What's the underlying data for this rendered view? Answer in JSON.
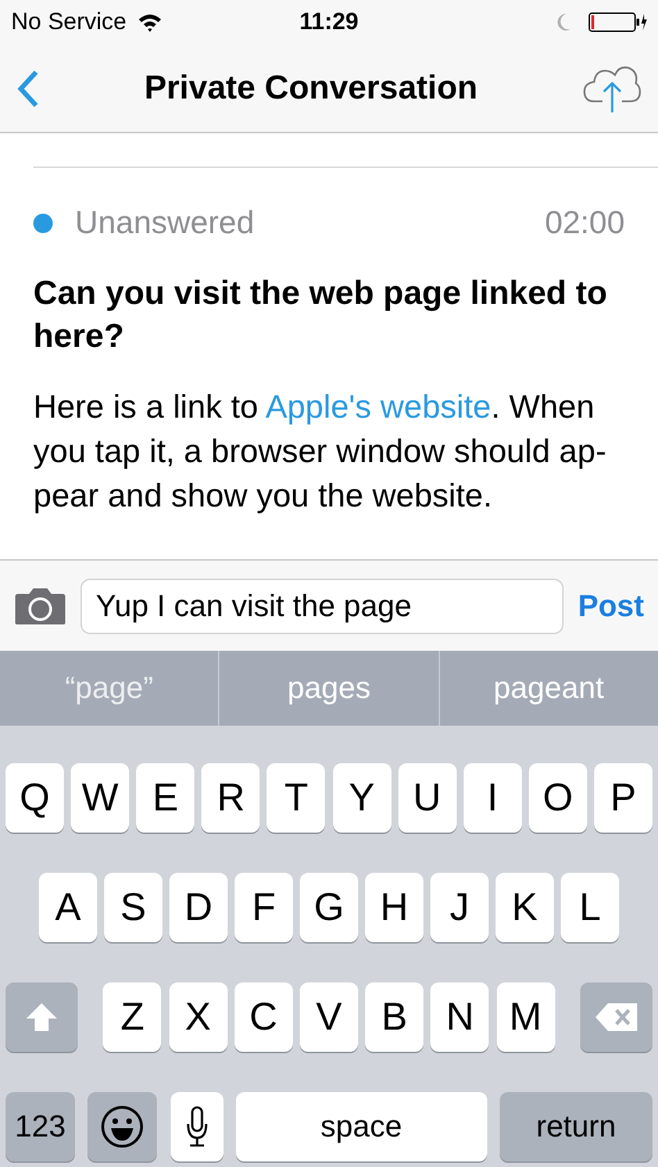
{
  "status_bar": {
    "carrier": "No Service",
    "time": "11:29"
  },
  "nav": {
    "title": "Private Conversation"
  },
  "question": {
    "status": "Unanswered",
    "color": "#2a9ae0",
    "time": "02:00",
    "title": "Can you visit the web page linked to here?",
    "body_before": "Here is a link to ",
    "link": "Apple's website",
    "body_after": ". When you tap it, a browser window should ap-pear and show you the website."
  },
  "composer": {
    "value": "Yup I can visit the page",
    "post": "Post"
  },
  "suggestions": [
    {
      "label": "“page”",
      "kind": "literal"
    },
    {
      "label": "pages",
      "kind": "word"
    },
    {
      "label": "pageant",
      "kind": "word"
    }
  ],
  "keyboard": {
    "top_letters": [
      "Q",
      "W",
      "E",
      "R",
      "T",
      "Y",
      "U",
      "I",
      "O",
      "P"
    ],
    "middle_letters": [
      "A",
      "S",
      "D",
      "F",
      "G",
      "H",
      "J",
      "K",
      "L"
    ],
    "bottom_letters": [
      "Z",
      "X",
      "C",
      "V",
      "B",
      "N",
      "M"
    ],
    "mode_key": "123",
    "space_key": "space",
    "return_key": "return"
  }
}
